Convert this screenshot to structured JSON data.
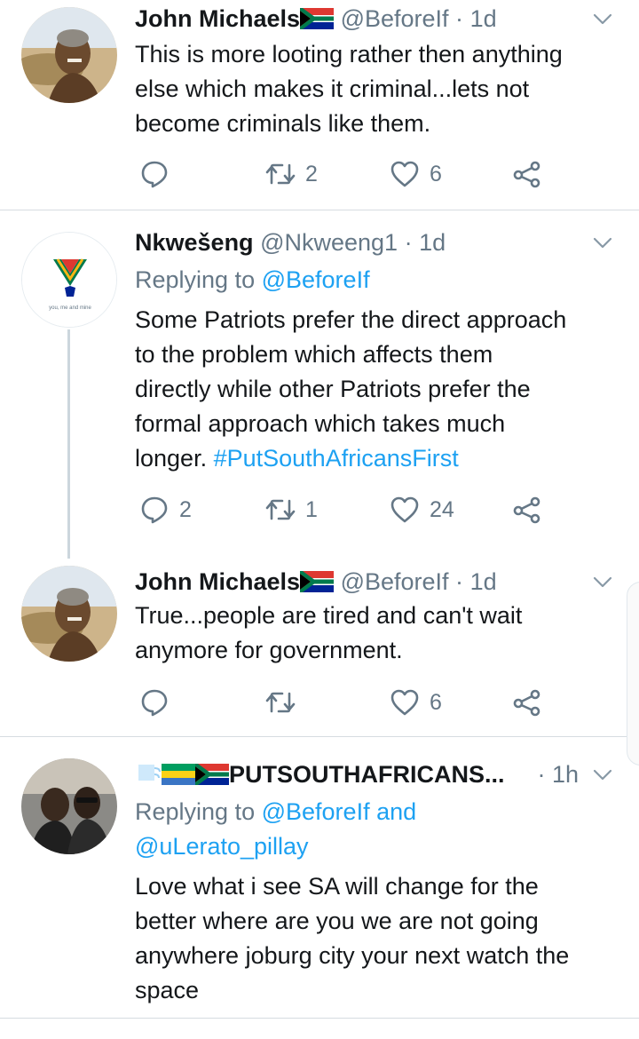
{
  "tweets": [
    {
      "name": "John Michaels",
      "flag": "south-africa-flag",
      "handle": "@BeforeIf",
      "dot": "·",
      "time": "1d",
      "body_lines": [
        "This is more looting rather then anything",
        "else which makes it criminal...lets not",
        "become criminals like them."
      ],
      "reply_count": "",
      "retweet_count": "2",
      "like_count": "6"
    },
    {
      "name": "Nkwešeng",
      "handle": "@Nkweeng1",
      "dot": "·",
      "time": "1d",
      "replying_label": "Replying to",
      "replying_to": "@BeforeIf",
      "body_lines": [
        "Some Patriots prefer the direct approach",
        "to the problem which affects them",
        "directly while other Patriots prefer the",
        "formal approach which takes much"
      ],
      "body_last": "longer.",
      "hashtag": "#PutSouthAfricansFirst",
      "avatar_caption": "you, me and mine",
      "reply_count": "2",
      "retweet_count": "1",
      "like_count": "24"
    },
    {
      "name": "John Michaels",
      "flag": "south-africa-flag",
      "handle": "@BeforeIf",
      "dot": "·",
      "time": "1d",
      "body_lines": [
        "True...people are tired and can't wait",
        "anymore for government."
      ],
      "reply_count": "",
      "retweet_count": "",
      "like_count": "6"
    },
    {
      "name": "PUTSOUTHAFRICANS...",
      "flags": [
        "wind-emoji",
        "gabon-flag",
        "south-africa-flag"
      ],
      "dot": "·",
      "time": "1h",
      "replying_label": "Replying to",
      "replying_to": "@BeforeIf",
      "replying_and": "and",
      "replying_to_2": "@uLerato_pillay",
      "body_lines": [
        "Love what i see SA will change for the",
        "better where are you we are not going",
        "anywhere joburg city your next watch the",
        "space"
      ]
    }
  ],
  "colors": {
    "link": "#1da1f2",
    "muted": "#657786",
    "text": "#14171a",
    "divider": "#d6dce1"
  }
}
